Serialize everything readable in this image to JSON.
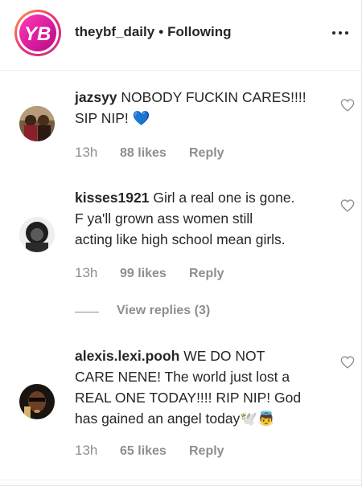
{
  "header": {
    "username": "theybf_daily",
    "separator": "•",
    "follow_status": "Following",
    "avatar_text": "YB"
  },
  "comments": [
    {
      "username": "jazsyy",
      "text_line1": "NOBODY FUCKIN CARES!!!!",
      "text_line2": "SIP NIP! 💙",
      "time": "13h",
      "likes": "88 likes",
      "reply": "Reply"
    },
    {
      "username": "kisses1921",
      "text_line1": "Girl a real one is gone.",
      "text_line2": "F ya'll grown ass women still",
      "text_line3": "acting like high school mean girls.",
      "time": "13h",
      "likes": "99 likes",
      "reply": "Reply"
    },
    {
      "username": "alexis.lexi.pooh",
      "text_line1": "WE DO NOT",
      "text_line2": "CARE NENE! The world just lost a",
      "text_line3": "REAL ONE TODAY!!!! RIP NIP! God",
      "text_line4": "has gained an angel today🕊️👼",
      "time": "13h",
      "likes": "65 likes",
      "reply": "Reply"
    }
  ],
  "view_replies": {
    "label": "View replies (3)"
  },
  "colors": {
    "text": "#262626",
    "secondary": "#8e8e8e",
    "heart_emoji": "#3897f0",
    "avatar_ring_start": "#f9a03a",
    "avatar_ring_end": "#c13584"
  },
  "icons": {
    "more": "more-options-icon",
    "like": "heart-outline-icon"
  }
}
